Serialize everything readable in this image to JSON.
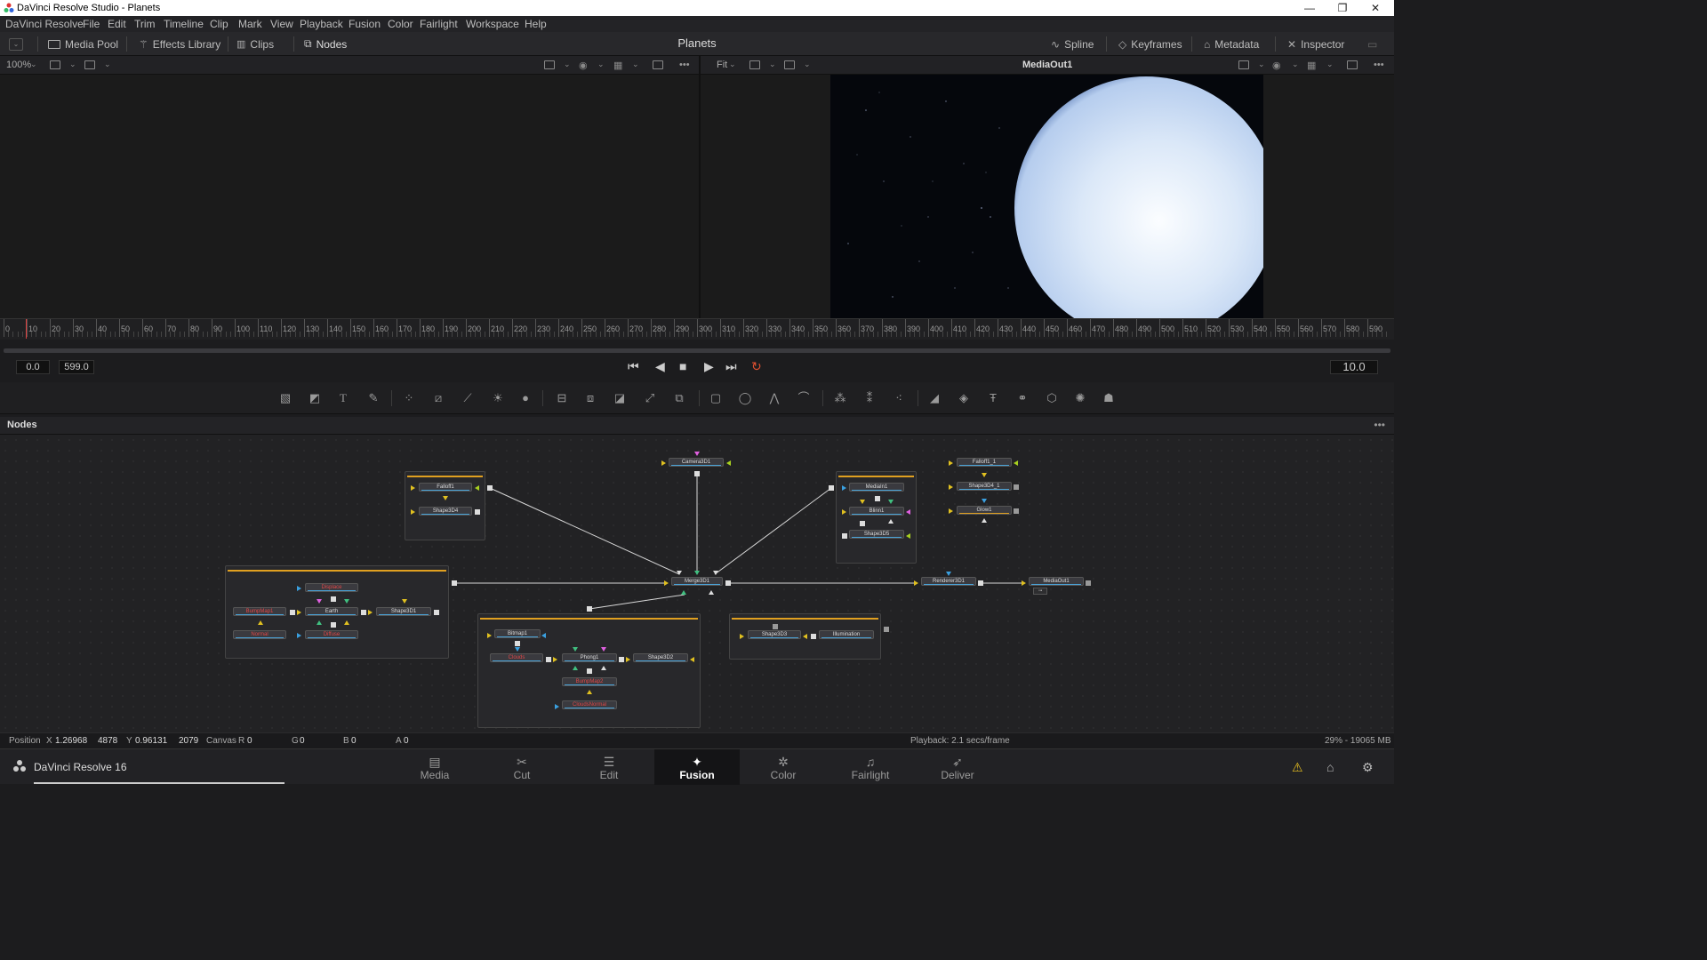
{
  "window": {
    "title": "DaVinci Resolve Studio - Planets",
    "minimize": "—",
    "maximize": "❐",
    "close": "✕"
  },
  "menu": [
    "DaVinci Resolve",
    "File",
    "Edit",
    "Trim",
    "Timeline",
    "Clip",
    "Mark",
    "View",
    "Playback",
    "Fusion",
    "Color",
    "Fairlight",
    "Workspace",
    "Help"
  ],
  "toolbar": {
    "media_pool": "Media Pool",
    "effects_library": "Effects Library",
    "clips": "Clips",
    "nodes": "Nodes",
    "project_title": "Planets",
    "spline": "Spline",
    "keyframes": "Keyframes",
    "metadata": "Metadata",
    "inspector": "Inspector"
  },
  "viewer_left": {
    "zoom": "100%"
  },
  "viewer_right": {
    "zoom": "Fit",
    "title": "MediaOut1"
  },
  "ruler_ticks": [
    "0",
    "10",
    "20",
    "30",
    "40",
    "50",
    "60",
    "70",
    "80",
    "90",
    "100",
    "110",
    "120",
    "130",
    "140",
    "150",
    "160",
    "170",
    "180",
    "190",
    "200",
    "210",
    "220",
    "230",
    "240",
    "250",
    "260",
    "270",
    "280",
    "290",
    "300",
    "310",
    "320",
    "330",
    "340",
    "350",
    "360",
    "370",
    "380",
    "390",
    "400",
    "410",
    "420",
    "430",
    "440",
    "450",
    "460",
    "470",
    "480",
    "490",
    "500",
    "510",
    "520",
    "530",
    "540",
    "550",
    "560",
    "570",
    "580",
    "590"
  ],
  "transport": {
    "start": "0.0",
    "end": "599.0",
    "current": "10.0"
  },
  "nodes_panel": {
    "title": "Nodes"
  },
  "nodes": {
    "falloff1": "Falloff1",
    "shape3d4": "Shape3D4",
    "camera3d1": "Camera3D1",
    "medialn1": "MediaIn1",
    "blinn1": "Blinn1",
    "shape3d5": "Shape3D5",
    "falloff1_1": "Falloff1_1",
    "shape3d4_1": "Shape3D4_1",
    "glow1": "Glow1",
    "displace": "Displace",
    "bumpmap1": "BumpMap1",
    "earth": "Earth",
    "shape3d1": "Shape3D1",
    "normal": "Normal",
    "diffuse": "Diffuse",
    "merge3d1": "Merge3D1",
    "renderer3d1": "Renderer3D1",
    "mediaout1": "MediaOut1",
    "bitmap1": "Bitmap1",
    "clouds": "Clouds",
    "phong1": "Phong1",
    "shape3d2": "Shape3D2",
    "bumpmap2": "BumpMap2",
    "cloudsnormal": "CloudsNormal",
    "shape3d3": "Shape3D3",
    "illumination": "Illumination"
  },
  "status": {
    "position_label": "Position",
    "x_label": "X",
    "x_value": "1.26968",
    "x_px": "4878",
    "y_label": "Y",
    "y_value": "0.96131",
    "y_px": "2079",
    "canvas_label": "Canvas",
    "r_label": "R",
    "r_value": "0",
    "g_label": "G",
    "g_value": "0",
    "b_label": "B",
    "b_value": "0",
    "a_label": "A",
    "a_value": "0",
    "playback": "Playback: 2.1 secs/frame",
    "memory": "29% - 19065 MB"
  },
  "pages": {
    "brand": "DaVinci Resolve 16",
    "media": "Media",
    "cut": "Cut",
    "edit": "Edit",
    "fusion": "Fusion",
    "color": "Color",
    "fairlight": "Fairlight",
    "deliver": "Deliver"
  },
  "colors": {
    "accent_orange": "#e0a020",
    "playhead": "#e04040",
    "node_highlight": "#4aa3d8"
  }
}
